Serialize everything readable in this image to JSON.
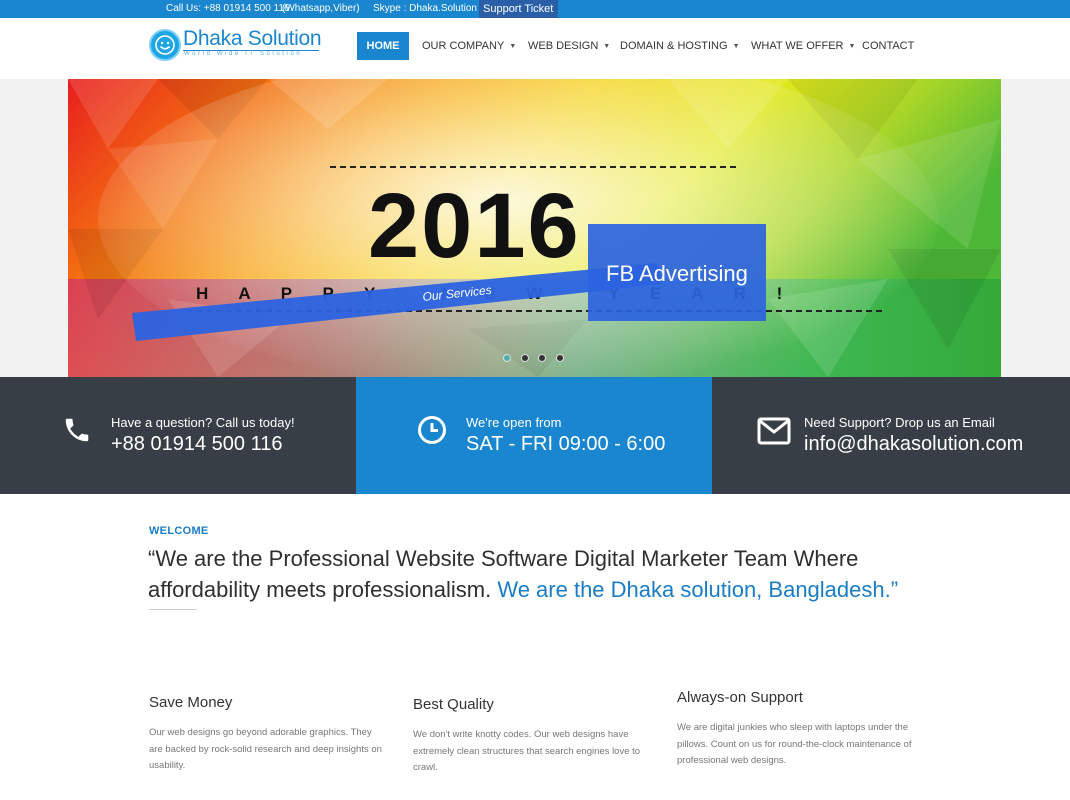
{
  "topbar": {
    "call": "Call Us: +88 01914 500 116",
    "call_note": "(Whatsapp,Viber)",
    "skype": "Skype : Dhaka.Solution",
    "ticket": "Support Ticket"
  },
  "logo": {
    "name": "Dhaka Solution",
    "tagline": "World Wide IT Solution"
  },
  "nav": {
    "items": [
      {
        "label": "HOME",
        "caret": false
      },
      {
        "label": "OUR COMPANY",
        "caret": true
      },
      {
        "label": "WEB DESIGN",
        "caret": true
      },
      {
        "label": "DOMAIN & HOSTING",
        "caret": true
      },
      {
        "label": "WHAT WE OFFER",
        "caret": true
      },
      {
        "label": "CONTACT",
        "caret": false
      }
    ]
  },
  "hero": {
    "year": "2016",
    "greeting": "H A P P Y   N E W   Y E A R !",
    "ribbon": "Our Services",
    "badge": "FB Advertising",
    "slides": 4,
    "active_slide": 1
  },
  "strip": [
    {
      "icon": "phone-icon",
      "label": "Have a question? Call us today!",
      "value": "+88 01914 500 116"
    },
    {
      "icon": "clock-icon",
      "label": "We're open from",
      "value": "SAT - FRI 09:00 - 6:00"
    },
    {
      "icon": "envelope-icon",
      "label": "Need Support? Drop us an Email",
      "value": "info@dhakasolution.com"
    }
  ],
  "welcome": {
    "label": "WELCOME",
    "quote_main": "“We are the Professional Website Software Digital Marketer Team Where affordability meets professionalism.",
    "quote_highlight": "We are the Dhaka solution, Bangladesh.”"
  },
  "features": [
    {
      "title": "Save Money",
      "text": "Our web designs go beyond adorable graphics. They are backed by rock-solid research and deep insights on usability."
    },
    {
      "title": "Best Quality",
      "text": "We don't write knotty codes. Our web designs have extremely clean structures that search engines love to crawl."
    },
    {
      "title": "Always-on Support",
      "text": "We are digital junkies who sleep with laptops under the pillows. Count on us for round-the-clock maintenance of professional web designs."
    }
  ],
  "colors": {
    "brand": "#1a86d0",
    "dark": "#383e45",
    "highlight": "#1a7cc4"
  }
}
